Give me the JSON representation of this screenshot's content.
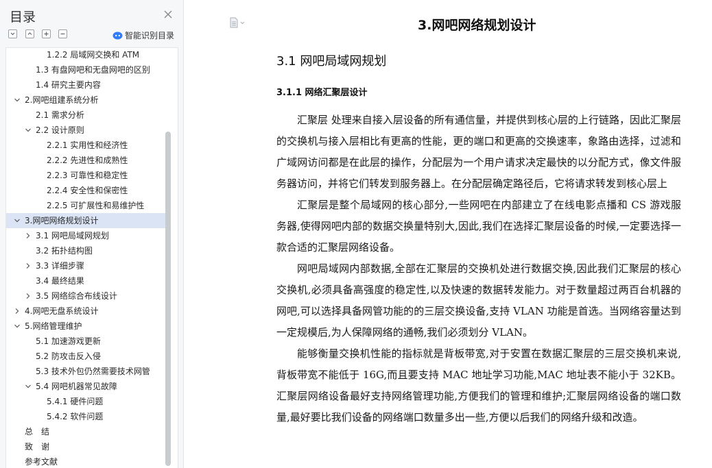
{
  "sidebar": {
    "title": "目录",
    "smart_toc_label": "智能识别目录",
    "items": [
      {
        "label": "1.2.2 局域网交换和 ATM",
        "level": 3,
        "expanded": null,
        "selected": false
      },
      {
        "label": "1.3 有盘网吧和无盘网吧的区别",
        "level": 2,
        "expanded": null,
        "selected": false
      },
      {
        "label": "1.4 研究主要内容",
        "level": 2,
        "expanded": null,
        "selected": false
      },
      {
        "label": "2.网吧组建系统分析",
        "level": 1,
        "expanded": true,
        "selected": false
      },
      {
        "label": "2.1 需求分析",
        "level": 2,
        "expanded": null,
        "selected": false
      },
      {
        "label": "2.2 设计原则",
        "level": 2,
        "expanded": true,
        "selected": false
      },
      {
        "label": "2.2.1 实用性和经济性",
        "level": 3,
        "expanded": null,
        "selected": false
      },
      {
        "label": "2.2.2 先进性和成熟性",
        "level": 3,
        "expanded": null,
        "selected": false
      },
      {
        "label": "2.2.3 可靠性和稳定性",
        "level": 3,
        "expanded": null,
        "selected": false
      },
      {
        "label": "2.2.4 安全性和保密性",
        "level": 3,
        "expanded": null,
        "selected": false
      },
      {
        "label": "2.2.5 可扩展性和易维护性",
        "level": 3,
        "expanded": null,
        "selected": false
      },
      {
        "label": "3.网吧网络规划设计",
        "level": 1,
        "expanded": true,
        "selected": true
      },
      {
        "label": "3.1 网吧局域网规划",
        "level": 2,
        "expanded": false,
        "selected": false
      },
      {
        "label": "3.2 拓扑结构图",
        "level": 2,
        "expanded": null,
        "selected": false
      },
      {
        "label": "3.3 详细步骤",
        "level": 2,
        "expanded": false,
        "selected": false
      },
      {
        "label": "3.4 最终结果",
        "level": 2,
        "expanded": null,
        "selected": false
      },
      {
        "label": "3.5 网络综合布线设计",
        "level": 2,
        "expanded": false,
        "selected": false
      },
      {
        "label": "4.网吧无盘系统设计",
        "level": 1,
        "expanded": false,
        "selected": false
      },
      {
        "label": "5.网络管理维护",
        "level": 1,
        "expanded": true,
        "selected": false
      },
      {
        "label": "5.1 加速游戏更新",
        "level": 2,
        "expanded": null,
        "selected": false
      },
      {
        "label": "5.2 防攻击反入侵",
        "level": 2,
        "expanded": null,
        "selected": false
      },
      {
        "label": "5.3 技术外包仍然需要技术网管",
        "level": 2,
        "expanded": null,
        "selected": false
      },
      {
        "label": "5.4 网吧机器常见故障",
        "level": 2,
        "expanded": true,
        "selected": false
      },
      {
        "label": "5.4.1 硬件问题",
        "level": 3,
        "expanded": null,
        "selected": false
      },
      {
        "label": "5.4.2 软件问题",
        "level": 3,
        "expanded": null,
        "selected": false
      },
      {
        "label": "总　结",
        "level": 1,
        "expanded": null,
        "selected": false
      },
      {
        "label": "致　谢",
        "level": 1,
        "expanded": null,
        "selected": false
      },
      {
        "label": "参考文献",
        "level": 1,
        "expanded": null,
        "selected": false
      }
    ]
  },
  "document": {
    "title": "3.网吧网络规划设计",
    "h2": "3.1 网吧局域网规划",
    "h3": "3.1.1 网络汇聚层设计",
    "paragraphs": [
      "汇聚层 处理来自接入层设备的所有通信量，并提供到核心层的上行链路，因此汇聚层的交换机与接入层相比有更高的性能，更的端口和更高的交换速率，象路由选择，过滤和广域网访问都是在此层的操作，分配层为一个用户请求决定最快的以分配方式，像文件服务器访问，并将它们转发到服务器上。在分配层确定路径后，它将请求转发到核心层上",
      "汇聚层是整个局域网的核心部分,一些网吧在内部建立了在线电影点播和 CS 游戏服务器,使得网吧内部的数据交换量特别大,因此,我们在选择汇聚层设备的时候,一定要选择一款合适的汇聚层网络设备。",
      "网吧局域网内部数据,全部在汇聚层的交换机处进行数据交换,因此我们汇聚层的核心交换机,必须具备高强度的稳定性,以及快速的数据转发能力。对于数量超过两百台机器的网吧,可以选择具备网管功能的的三层交换设备,支持 VLAN 功能是首选。当网络容量达到一定规模后,为人保障网络的通畅,我们必须划分 VLAN。",
      "能够衡量交换机性能的指标就是背板带宽,对于安置在数据汇聚层的三层交换机来说,背板带宽不能低于 16G,而且要支持 MAC 地址学习功能,MAC 地址表不能小于 32KB。汇聚层网络设备最好支持网络管理功能,方便我们的管理和维护;汇聚层网络设备的端口数量,最好要比我们设备的网络端口数量多出一些,方便以后我们的网络升级和改造。"
    ]
  },
  "colors": {
    "sidebar_bg": "#f6f7f9",
    "selected_bg": "#dbe4f5",
    "scrollbar": "#c9cccf",
    "accent_icon": "#2f7cf6"
  },
  "icons": {
    "close": "close-icon",
    "collapse_all": "collapse-all-icon",
    "expand_up": "chevron-up-box-icon",
    "expand": "plus-box-icon",
    "collapse": "minus-box-icon",
    "smart_toc": "smart-robot-icon",
    "doc_menu": "document-icon"
  }
}
